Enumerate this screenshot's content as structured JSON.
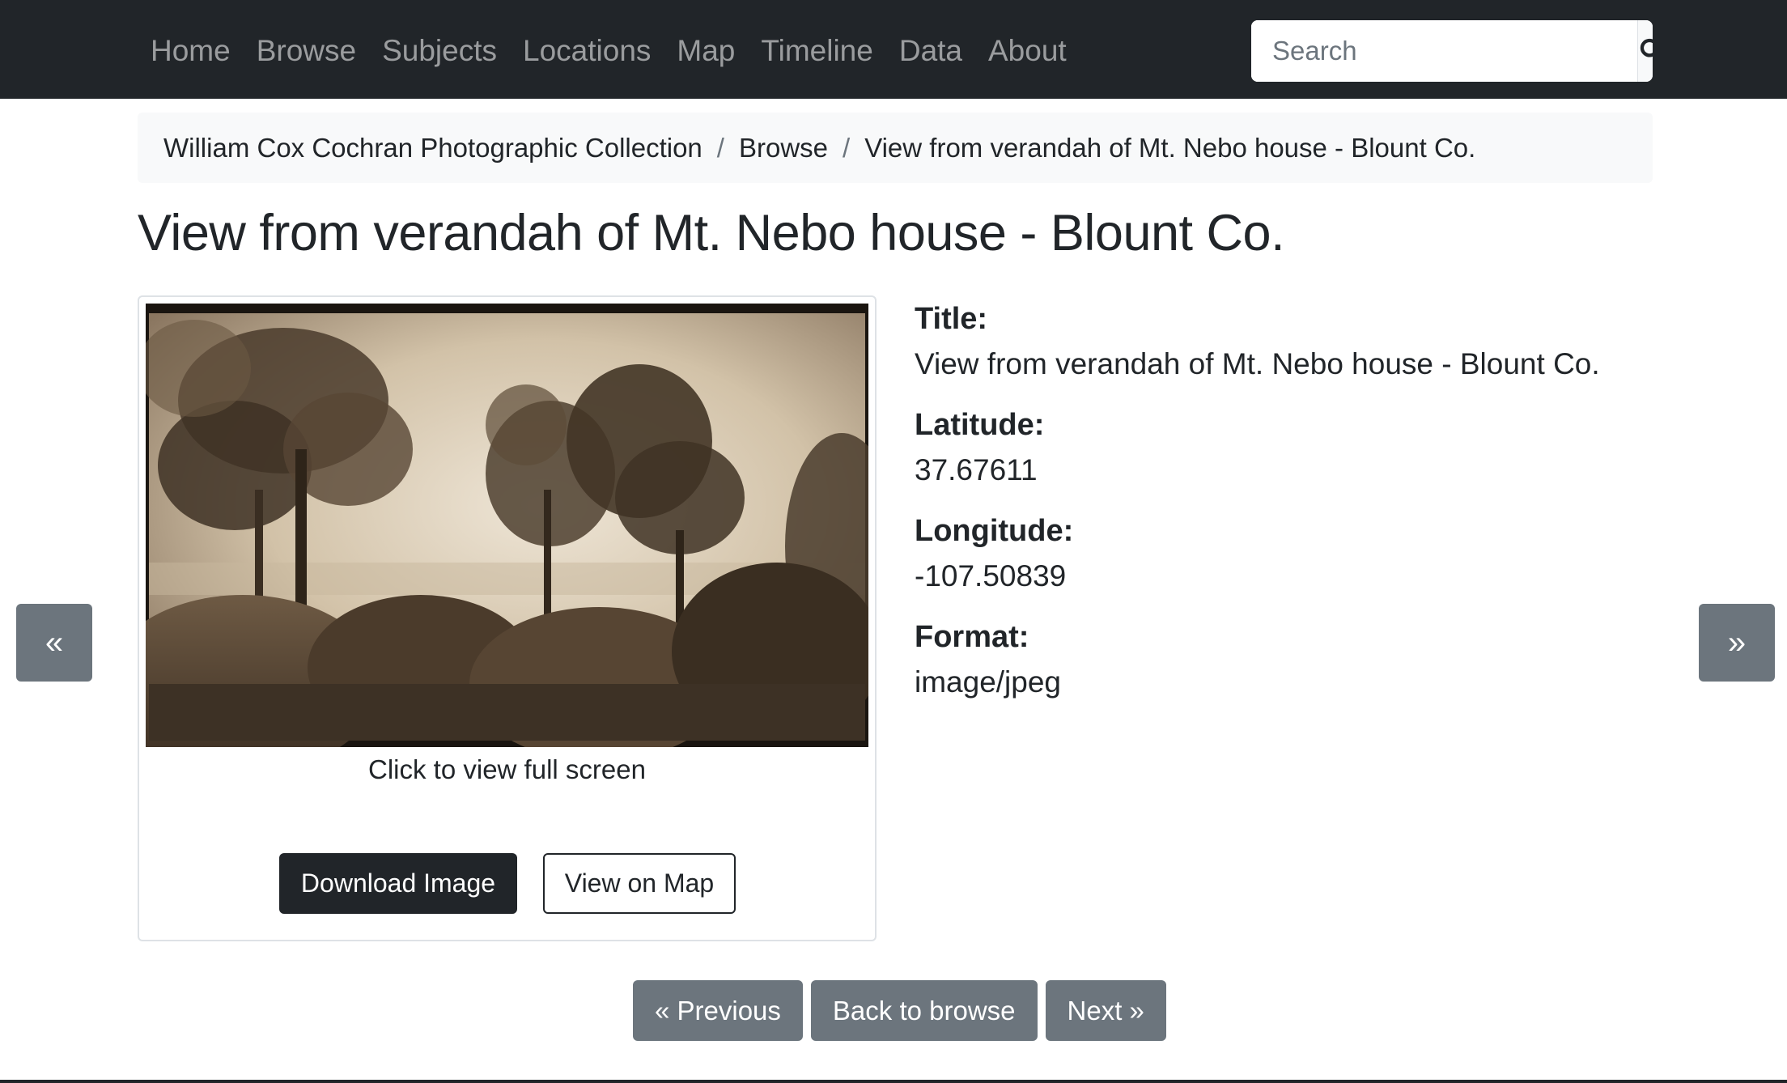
{
  "nav": {
    "items": [
      {
        "label": "Home"
      },
      {
        "label": "Browse"
      },
      {
        "label": "Subjects"
      },
      {
        "label": "Locations"
      },
      {
        "label": "Map"
      },
      {
        "label": "Timeline"
      },
      {
        "label": "Data"
      },
      {
        "label": "About"
      }
    ],
    "search": {
      "placeholder": "Search",
      "value": ""
    },
    "search_icon": "search-icon"
  },
  "breadcrumb": {
    "items": [
      {
        "label": "William Cox Cochran Photographic Collection"
      },
      {
        "label": "Browse"
      },
      {
        "label": "View from verandah of Mt. Nebo house - Blount Co."
      }
    ],
    "separator": "/"
  },
  "page": {
    "title": "View from verandah of Mt. Nebo house - Blount Co."
  },
  "image_panel": {
    "caption": "Click to view full screen",
    "download_label": "Download Image",
    "map_label": "View on Map"
  },
  "metadata": [
    {
      "label": "Title:",
      "value": "View from verandah of Mt. Nebo house - Blount Co."
    },
    {
      "label": "Latitude:",
      "value": "37.67611"
    },
    {
      "label": "Longitude:",
      "value": "-107.50839"
    },
    {
      "label": "Format:",
      "value": "image/jpeg"
    }
  ],
  "side_nav": {
    "prev_label": "«",
    "next_label": "»"
  },
  "bottom_nav": {
    "previous_label": "« Previous",
    "back_label": "Back to browse",
    "next_label": "Next »"
  },
  "colors": {
    "navbar": "#212529",
    "secondary": "#6c757d",
    "breadcrumb_bg": "#f8f9fa"
  }
}
